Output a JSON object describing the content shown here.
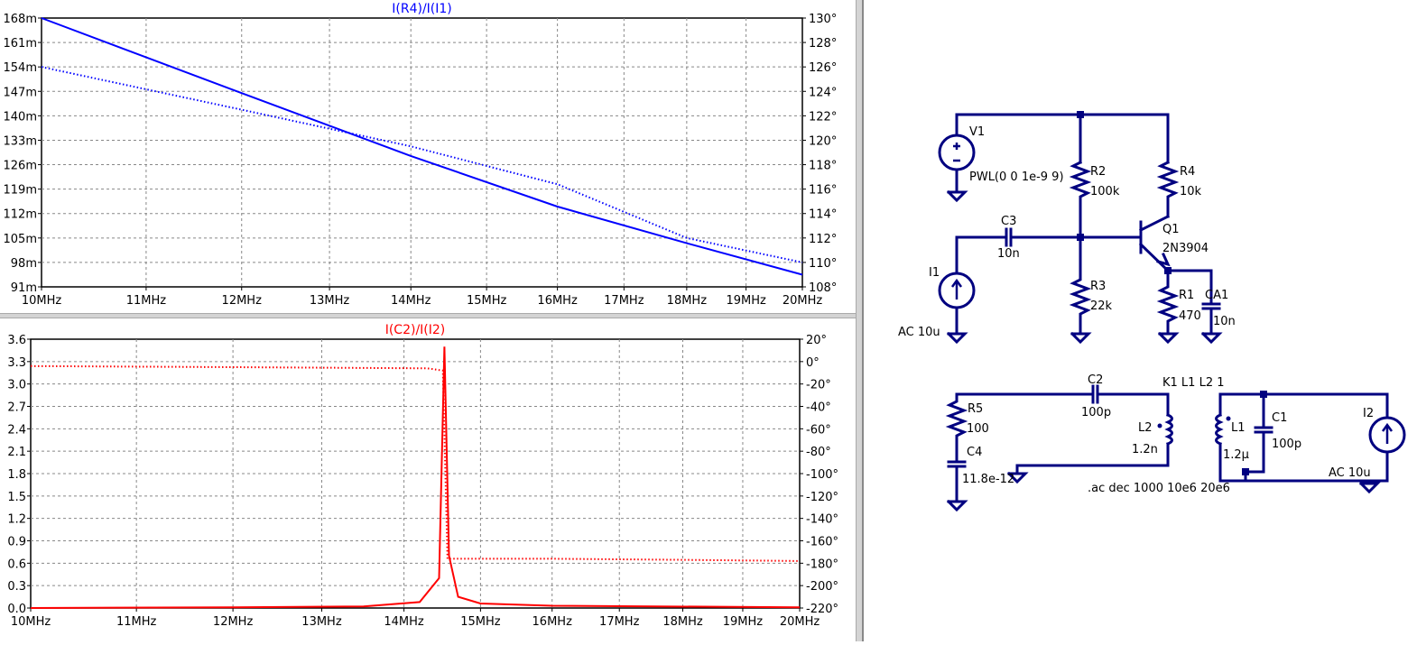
{
  "plot_top": {
    "title": "I(R4)/I(I1)",
    "color": "#0000ff",
    "xticks": [
      "10MHz",
      "11MHz",
      "12MHz",
      "13MHz",
      "14MHz",
      "15MHz",
      "16MHz",
      "17MHz",
      "18MHz",
      "19MHz",
      "20MHz"
    ],
    "left_ticks": [
      "168m",
      "161m",
      "154m",
      "147m",
      "140m",
      "133m",
      "126m",
      "119m",
      "112m",
      "105m",
      "98m",
      "91m"
    ],
    "right_ticks": [
      "130°",
      "128°",
      "126°",
      "124°",
      "122°",
      "120°",
      "118°",
      "116°",
      "114°",
      "112°",
      "110°",
      "108°"
    ]
  },
  "plot_bottom": {
    "title": "I(C2)/I(I2)",
    "color": "#ff0000",
    "xticks": [
      "10MHz",
      "11MHz",
      "12MHz",
      "13MHz",
      "14MHz",
      "15MHz",
      "16MHz",
      "17MHz",
      "18MHz",
      "19MHz",
      "20MHz"
    ],
    "left_ticks": [
      "3.6",
      "3.3",
      "3.0",
      "2.7",
      "2.4",
      "2.1",
      "1.8",
      "1.5",
      "1.2",
      "0.9",
      "0.6",
      "0.3",
      "0.0"
    ],
    "right_ticks": [
      "20°",
      "0°",
      "-20°",
      "-40°",
      "-60°",
      "-80°",
      "-100°",
      "-120°",
      "-140°",
      "-160°",
      "-180°",
      "-200°",
      "-220°"
    ]
  },
  "chart_data": [
    {
      "type": "line",
      "title": "I(R4)/I(I1)",
      "x_scale": "log",
      "xlim": [
        "10MHz",
        "20MHz"
      ],
      "ylim": [
        0.091,
        0.168
      ],
      "y2lim": [
        108,
        130
      ],
      "series": [
        {
          "style": "solid",
          "axis": "left",
          "x": [
            10000000.0,
            12000000.0,
            14000000.0,
            16000000.0,
            18000000.0,
            20000000.0
          ],
          "values": [
            0.168,
            0.1465,
            0.1285,
            0.114,
            0.1035,
            0.0945
          ]
        },
        {
          "style": "dotted",
          "axis": "right",
          "x": [
            10000000.0,
            12000000.0,
            14000000.0,
            16000000.0,
            18000000.0,
            20000000.0
          ],
          "values": [
            126.0,
            122.5,
            119.5,
            116.4,
            112.0,
            110.0
          ]
        }
      ]
    },
    {
      "type": "line",
      "title": "I(C2)/I(I2)",
      "x_scale": "log",
      "xlim": [
        "10MHz",
        "20MHz"
      ],
      "ylim": [
        0.0,
        3.6
      ],
      "y2lim": [
        -220,
        20
      ],
      "series": [
        {
          "style": "solid",
          "axis": "left",
          "x": [
            10000000.0,
            12000000.0,
            13500000.0,
            14200000.0,
            14450000.0,
            14520000.0,
            14580000.0,
            14700000.0,
            15000000.0,
            16000000.0,
            20000000.0
          ],
          "values": [
            0.0,
            0.01,
            0.02,
            0.08,
            0.4,
            3.5,
            0.7,
            0.15,
            0.06,
            0.03,
            0.01
          ]
        },
        {
          "style": "dotted",
          "axis": "right",
          "x": [
            10000000.0,
            12000000.0,
            14300000.0,
            14500000.0,
            14560000.0,
            16000000.0,
            18000000.0,
            20000000.0
          ],
          "values": [
            -4,
            -5,
            -6,
            -8,
            -176,
            -176,
            -177,
            -178
          ]
        }
      ]
    }
  ],
  "schematic": {
    "labels": {
      "v1": "V1",
      "v1_value": "PWL(0 0 1e-9 9)",
      "r2": "R2",
      "r2_value": "100k",
      "r4": "R4",
      "r4_value": "10k",
      "c3": "C3",
      "c3_value": "10n",
      "q1": "Q1",
      "q1_value": "2N3904",
      "i1": "I1",
      "i1_value": "AC 10u",
      "r3": "R3",
      "r3_value": "22k",
      "r1": "R1",
      "r1_value": "470",
      "ca1": "CA1",
      "ca1_value": "10n",
      "c2": "C2",
      "c2_value": "100p",
      "k1": "K1 L1 L2 1",
      "r5": "R5",
      "r5_value": "100",
      "l2": "L2",
      "l2_value": "1.2n",
      "l1": "L1",
      "l1_value": "1.2µ",
      "c1": "C1",
      "c1_value": "100p",
      "i2": "I2",
      "i2_value": "AC 10u",
      "c4": "C4",
      "c4_value": "11.8e-12",
      "ac_directive": ".ac dec 1000 10e6 20e6"
    }
  }
}
